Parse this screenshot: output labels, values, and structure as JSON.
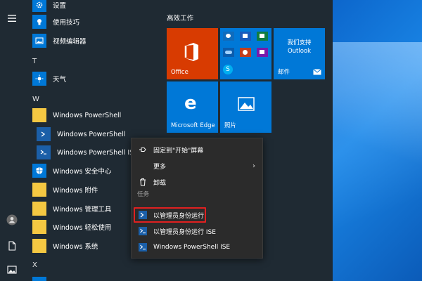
{
  "rail": {
    "icons": [
      "menu-icon",
      "user-icon",
      "document-icon",
      "pictures-icon"
    ]
  },
  "apps": {
    "settings": "设置",
    "tips": "使用技巧",
    "video_editor": "视频编辑器",
    "letter_t": "T",
    "weather": "天气",
    "letter_w": "W",
    "ps_folder": "Windows PowerShell",
    "ps": "Windows PowerShell",
    "ps_ise": "Windows PowerShell ISE",
    "security": "Windows 安全中心",
    "accessories": "Windows 附件",
    "admin_tools": "Windows 管理工具",
    "ease": "Windows 轻松使用",
    "system": "Windows 系统",
    "letter_x": "X"
  },
  "tiles": {
    "header": "高效工作",
    "office": "Office",
    "we_support": "我们支持",
    "outlook": "Outlook",
    "mail": "邮件",
    "edge": "Microsoft Edge",
    "photos": "照片"
  },
  "context_menu": {
    "pin": "固定到\"开始\"屏幕",
    "more": "更多",
    "uninstall": "卸载",
    "tasks_header": "任务",
    "run_admin": "以管理员身份运行",
    "run_ise_admin": "以管理员身份运行 ISE",
    "ps_ise": "Windows PowerShell ISE"
  },
  "colors": {
    "start_bg": "#1f2a33",
    "tile_blue": "#0078d7",
    "office_orange": "#d83b01",
    "folder_yellow": "#f5c842",
    "highlight_red": "#e02020"
  }
}
